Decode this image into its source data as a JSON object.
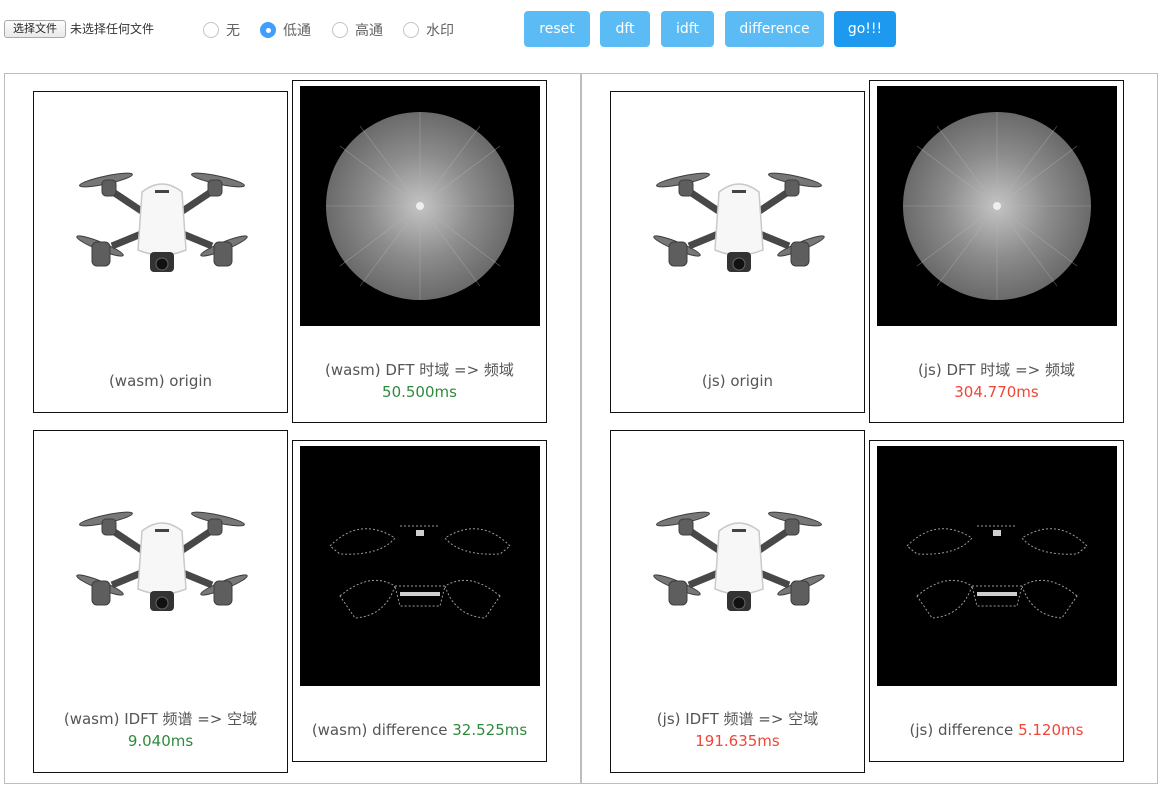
{
  "toolbar": {
    "file_button": "选择文件",
    "file_status": "未选择任何文件",
    "filter_options": [
      {
        "label": "无",
        "checked": false
      },
      {
        "label": "低通",
        "checked": true
      },
      {
        "label": "高通",
        "checked": false
      },
      {
        "label": "水印",
        "checked": false
      }
    ],
    "buttons": {
      "reset": "reset",
      "dft": "dft",
      "idft": "idft",
      "difference": "difference",
      "go": "go!!!"
    }
  },
  "wasm": {
    "origin": {
      "caption": "(wasm) origin"
    },
    "dft": {
      "caption": "(wasm) DFT 时域 => 频域",
      "time": "50.500ms"
    },
    "idft": {
      "caption": "(wasm) IDFT 频谱 => 空域",
      "time": "9.040ms"
    },
    "difference": {
      "caption": "(wasm) difference",
      "time": "32.525ms"
    }
  },
  "js": {
    "origin": {
      "caption": "(js) origin"
    },
    "dft": {
      "caption": "(js) DFT 时域 => 频域",
      "time": "304.770ms"
    },
    "idft": {
      "caption": "(js) IDFT 频谱 => 空域",
      "time": "191.635ms"
    },
    "difference": {
      "caption": "(js) difference",
      "time": "5.120ms"
    }
  },
  "colors": {
    "fast_time": "#2f8a3d",
    "slow_time": "#f04638",
    "radio_accent": "#409eff",
    "button_light": "#5bbcf5",
    "button_primary": "#1e99f0"
  }
}
